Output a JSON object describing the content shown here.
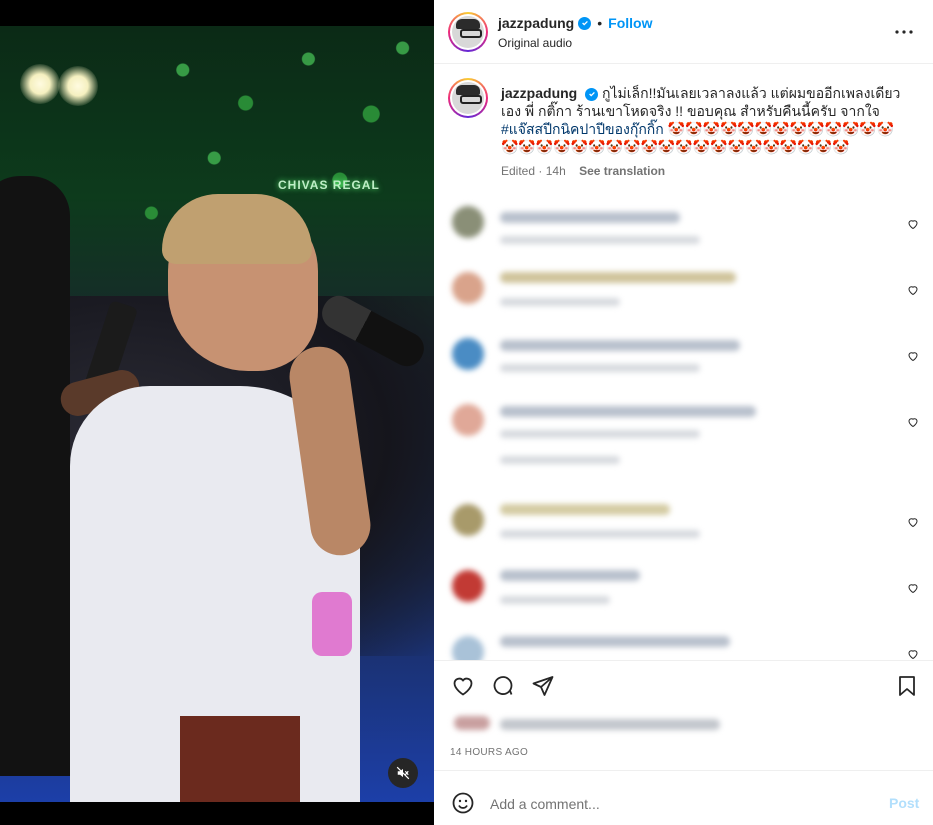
{
  "post": {
    "username": "jazzpadung",
    "follow_label": "Follow",
    "audio_label": "Original audio",
    "caption_text": "กูไม่เล็ก!!มันเลยเวลาลงแล้ว แต่ผมขออีกเพลงเดียวเอง พี่ กติ๊กา ร้านเขาโหดจริง !! ขอบคุณ สำหรับคืนนี้ครับ จากใจ",
    "caption_hashtag": "#แจ๊สสปีกนิคปาปีของกุ๊กกิ๊ก",
    "caption_emojis": "🤡🤡🤡🤡🤡🤡🤡🤡🤡🤡🤡🤡🤡🤡🤡🤡🤡🤡🤡🤡🤡🤡🤡🤡🤡🤡🤡🤡🤡🤡🤡🤡🤡",
    "edited_label": "Edited",
    "time_ago": "14h",
    "see_translation": "See translation",
    "timestamp": "14 HOURS AGO"
  },
  "media": {
    "brand_sign": "CHIVAS REGAL"
  },
  "comment_box": {
    "placeholder": "Add a comment...",
    "post_label": "Post"
  },
  "icons": {
    "more": "more-options-icon",
    "verified": "verified-badge-icon",
    "like": "heart-icon",
    "comment": "comment-icon",
    "share": "send-icon",
    "save": "bookmark-icon",
    "emoji": "emoji-icon",
    "mute": "muted-speaker-icon"
  },
  "colors": {
    "accent": "#0095f6",
    "hashtag": "#00376b",
    "secondary_text": "#737373"
  }
}
